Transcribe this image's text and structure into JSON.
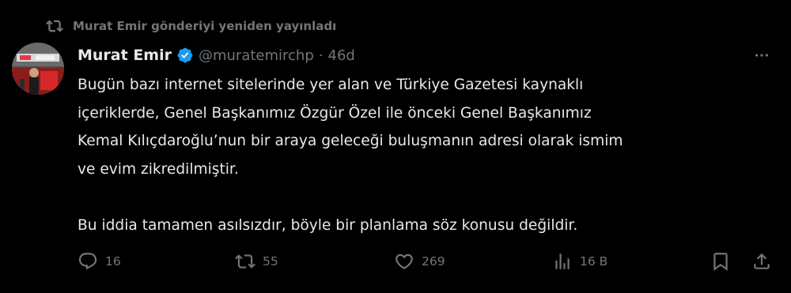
{
  "repost": {
    "label": "Murat Emir gönderiyi yeniden yayınladı",
    "icon": "repost-icon"
  },
  "author": {
    "name": "Murat Emir",
    "verified_icon": "verified-badge-icon",
    "handle": "@muratemirchp",
    "separator": "·",
    "time": "46d"
  },
  "more_icon": "more-options-icon",
  "tweet": {
    "text": "Bugün bazı internet sitelerinde yer alan ve Türkiye Gazetesi kaynaklı\niçeriklerde, Genel Başkanımız Özgür Özel ile önceki Genel Başkanımız\nKemal Kılıçdaroğlu’nun bir araya geleceği buluşmanın adresi olarak ismim\nve evim zikredilmiştir.\n\nBu iddia tamamen asılsızdır, böyle bir planlama söz konusu değildir."
  },
  "actions": {
    "replies": "16",
    "reposts": "55",
    "likes": "269",
    "views": "16 B"
  },
  "colors": {
    "background": "#000000",
    "text": "#e7e9ea",
    "muted": "#71767b",
    "verified": "#1d9bf0"
  }
}
